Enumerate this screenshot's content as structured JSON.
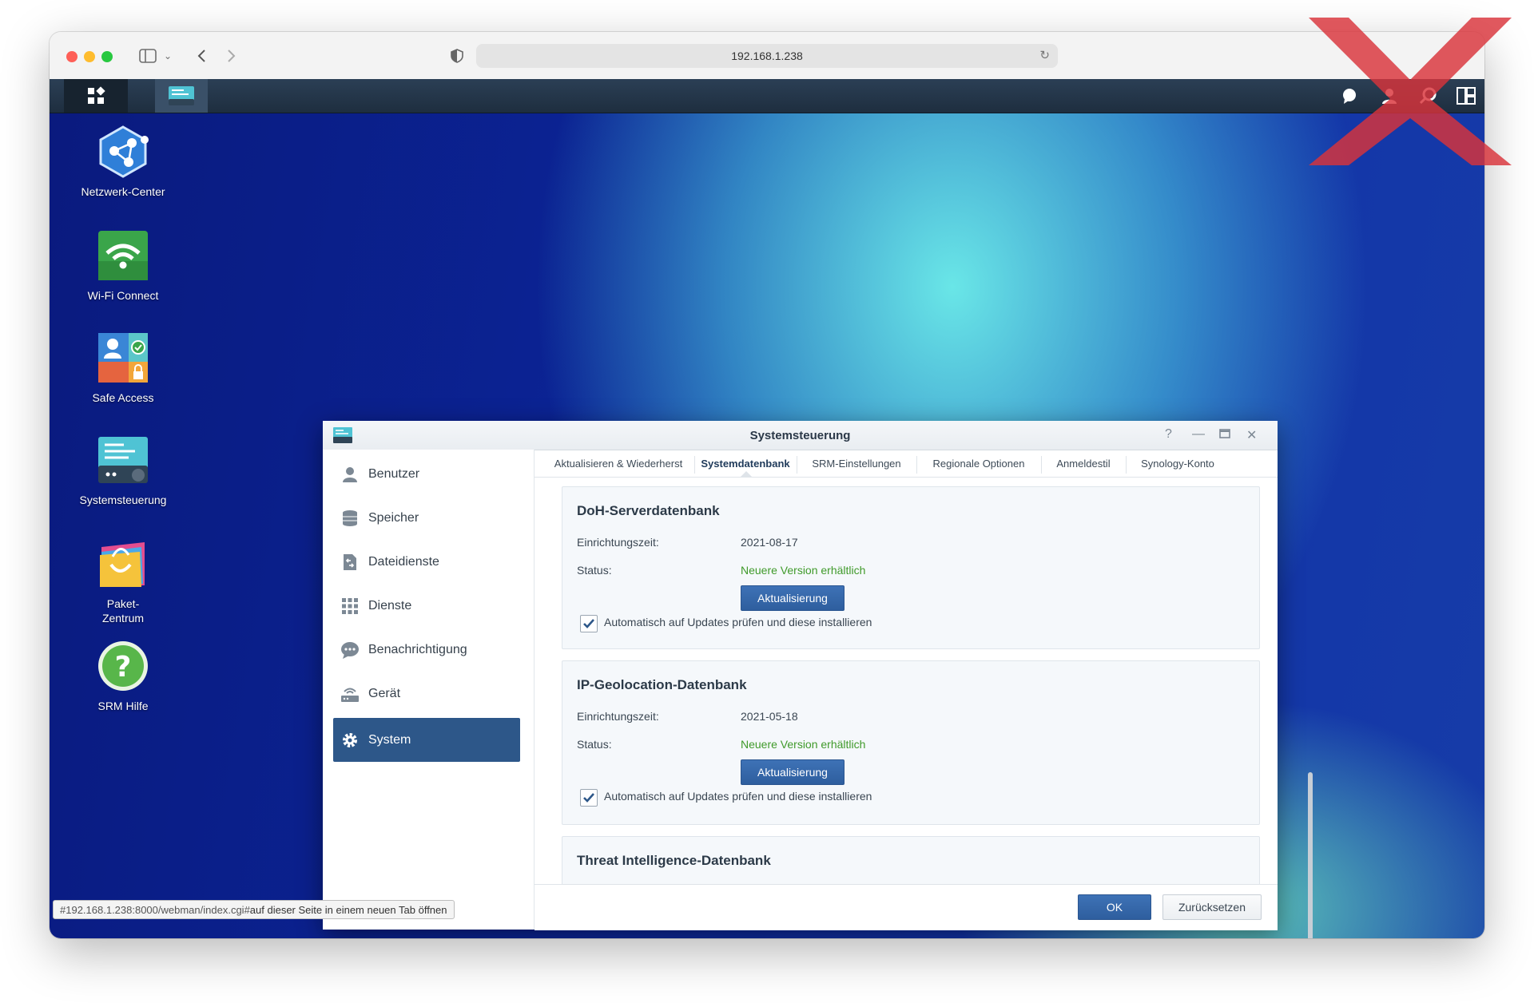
{
  "browser": {
    "url": "192.168.1.238",
    "status_url": "#192.168.1.238:8000/webman/index.cgi#",
    "status_suffix": " auf dieser Seite in einem neuen Tab öffnen"
  },
  "desktop": {
    "icons": [
      {
        "label": "Netzwerk-Center",
        "icon": "network-center-icon"
      },
      {
        "label": "Wi-Fi Connect",
        "icon": "wifi-connect-icon"
      },
      {
        "label": "Safe Access",
        "icon": "safe-access-icon"
      },
      {
        "label": "Systemsteuerung",
        "icon": "control-panel-icon"
      },
      {
        "label": "Paket-",
        "label2": "Zentrum",
        "icon": "package-center-icon"
      },
      {
        "label": "SRM Hilfe",
        "icon": "help-icon"
      }
    ]
  },
  "window": {
    "title": "Systemsteuerung",
    "sidebar": [
      {
        "label": "Benutzer",
        "icon": "user-icon"
      },
      {
        "label": "Speicher",
        "icon": "storage-icon"
      },
      {
        "label": "Dateidienste",
        "icon": "file-services-icon"
      },
      {
        "label": "Dienste",
        "icon": "services-icon"
      },
      {
        "label": "Benachrichtigung",
        "icon": "notification-icon"
      },
      {
        "label": "Gerät",
        "icon": "device-icon"
      },
      {
        "label": "System",
        "icon": "gear-icon",
        "active": true
      }
    ],
    "tabs": [
      {
        "label": "Aktualisieren & Wiederherst"
      },
      {
        "label": "Systemdatenbank",
        "active": true
      },
      {
        "label": "SRM-Einstellungen"
      },
      {
        "label": "Regionale Optionen"
      },
      {
        "label": "Anmeldestil"
      },
      {
        "label": "Synology-Konto"
      }
    ],
    "cards": [
      {
        "title": "DoH-Serverdatenbank",
        "setup_label": "Einrichtungszeit:",
        "setup_value": "2021-08-17",
        "status_label": "Status:",
        "status_value": "Neuere Version erhältlich",
        "button": "Aktualisierung",
        "checkbox_label": "Automatisch auf Updates prüfen und diese installieren"
      },
      {
        "title": "IP-Geolocation-Datenbank",
        "setup_label": "Einrichtungszeit:",
        "setup_value": "2021-05-18",
        "status_label": "Status:",
        "status_value": "Neuere Version erhältlich",
        "button": "Aktualisierung",
        "checkbox_label": "Automatisch auf Updates prüfen und diese installieren"
      },
      {
        "title": "Threat Intelligence-Datenbank"
      }
    ],
    "footer": {
      "ok": "OK",
      "reset": "Zurücksetzen"
    }
  },
  "colors": {
    "accent": "#2d5789",
    "status_ok": "#3f9a2a"
  }
}
